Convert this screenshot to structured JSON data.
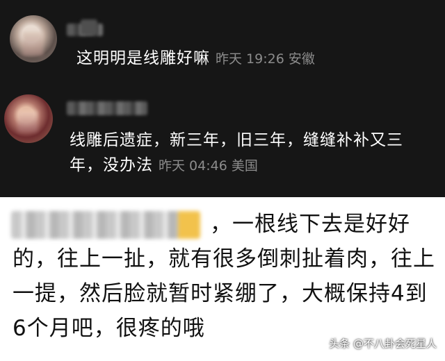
{
  "comments": [
    {
      "text": "这明明是线雕好嘛",
      "time": "昨天 19:26 安徽"
    },
    {
      "text": "线雕后遗症，新三年，旧三年，缝缝补补又三年，没办法",
      "time": "昨天 04:46 美国"
    }
  ],
  "reply": {
    "text": "，一根线下去是好好的，往上一扯，就有很多倒刺扯着肉，往上一提，然后脸就暂时紧绷了，大概保持4到6个月吧，很疼的哦"
  },
  "watermark": "头条 @不八卦会死星人",
  "colors": {
    "dark_background": "#161616",
    "meta_text": "#8c8c8c"
  }
}
